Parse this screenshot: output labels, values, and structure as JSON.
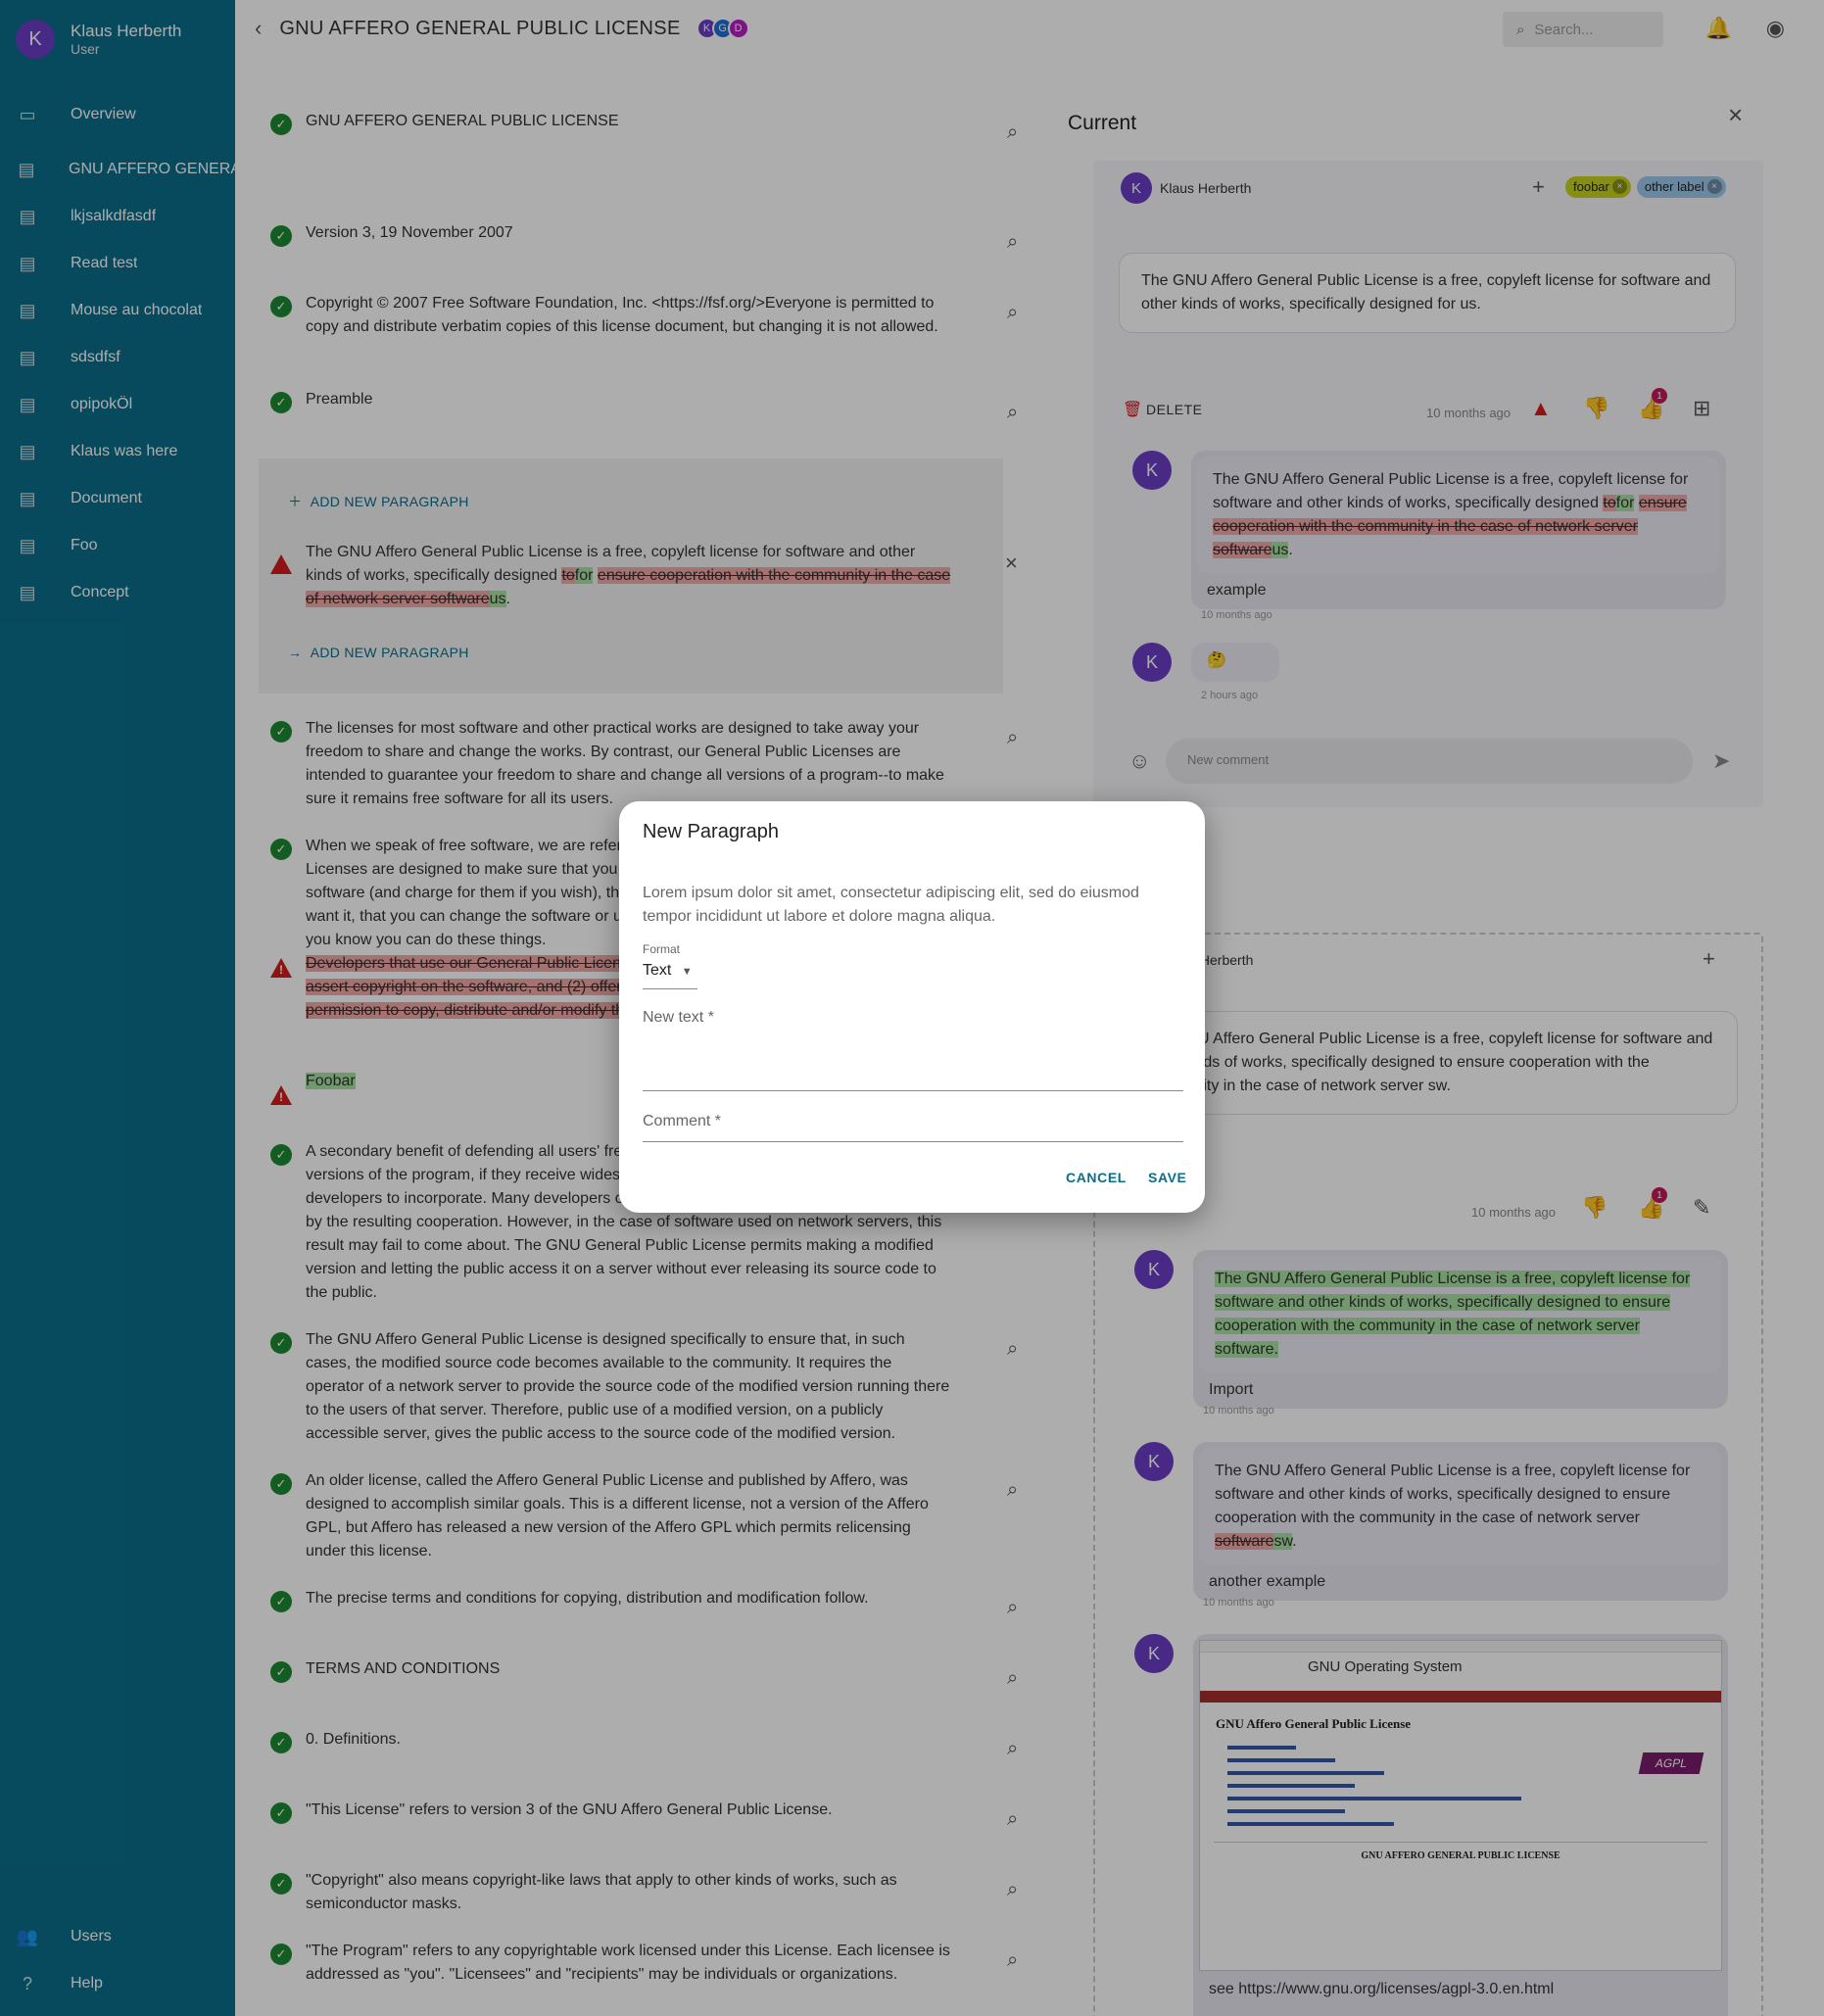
{
  "user": {
    "initial": "K",
    "name": "Klaus Herberth",
    "role": "User"
  },
  "sidebar": {
    "items": [
      {
        "label": "Overview",
        "icon": "overview-icon"
      },
      {
        "label": "GNU AFFERO GENERAL PUBLIC LICENSE",
        "icon": "document-icon"
      },
      {
        "label": "lkjsalkdfasdf",
        "icon": "document-icon"
      },
      {
        "label": "Read test",
        "icon": "document-icon"
      },
      {
        "label": "Mouse au chocolat",
        "icon": "document-icon"
      },
      {
        "label": "sdsdfsf",
        "icon": "document-icon"
      },
      {
        "label": "opipokÖl",
        "icon": "document-icon"
      },
      {
        "label": "Klaus was here",
        "icon": "document-icon"
      },
      {
        "label": "Document",
        "icon": "document-icon"
      },
      {
        "label": "Foo",
        "icon": "document-icon"
      },
      {
        "label": "Concept",
        "icon": "document-icon"
      }
    ],
    "bottom": [
      {
        "label": "Users",
        "icon": "users-icon"
      },
      {
        "label": "Help",
        "icon": "help-icon"
      }
    ]
  },
  "topbar": {
    "title": "GNU AFFERO GENERAL PUBLIC LICENSE",
    "participants": [
      {
        "initial": "K",
        "color": "#6a3fc6"
      },
      {
        "initial": "G",
        "color": "#1e6fd9"
      },
      {
        "initial": "D",
        "color": "#b81ec2"
      }
    ],
    "search_placeholder": "Search..."
  },
  "document": {
    "title": "GNU AFFERO GENERAL PUBLIC LICENSE",
    "version": "Version 3, 19 November 2007",
    "copyright": "Copyright © 2007 Free Software Foundation, Inc. <https://fsf.org/>Everyone is permitted to copy and distribute verbatim copies of this license document, but changing it is not allowed.",
    "preamble": "Preamble",
    "add_new_paragraph": "ADD NEW PARAGRAPH",
    "edit_para": {
      "prefix": "The GNU Affero General Public License is a free, copyleft license for software and other kinds of works, specifically designed ",
      "del1": "to",
      "ins1": "for",
      "del2": "ensure cooperation with the community in the case of network server software",
      "ins2": "us",
      "suffix": "."
    },
    "p1": "The licenses for most software and other practical works are designed to take away your freedom to share and change the works. By contrast, our General Public Licenses are intended to guarantee your freedom to share and change all versions of a program--to make sure it remains free software for all its users.",
    "p2": "When we speak of free software, we are referring to freedom, not price. Our General Public Licenses are designed to make sure that you have the freedom to distribute copies of free software (and charge for them if you wish), that you receive source code or can get it if you want it, that you can change the software or use pieces of it in new free programs, and that you know you can do these things.",
    "p3_deleted": "Developers that use our General Public Licenses protect your rights with two steps: (1) assert copyright on the software, and (2) offer you this License which gives you legal permission to copy, distribute and/or modify the software.",
    "p4_inserted": "Foobar",
    "p5": "A secondary benefit of defending all users' freedom is that improvements made in alternate versions of the program, if they receive widespread use, become available for other developers to incorporate. Many developers of free software are heartened and encouraged by the resulting cooperation. However, in the case of software used on network servers, this result may fail to come about. The GNU General Public License permits making a modified version and letting the public access it on a server without ever releasing its source code to the public.",
    "p6": "The GNU Affero General Public License is designed specifically to ensure that, in such cases, the modified source code becomes available to the community. It requires the operator of a network server to provide the source code of the modified version running there to the users of that server. Therefore, public use of a modified version, on a publicly accessible server, gives the public access to the source code of the modified version.",
    "p7": "An older license, called the Affero General Public License and published by Affero, was designed to accomplish similar goals. This is a different license, not a version of the Affero GPL, but Affero has released a new version of the Affero GPL which permits relicensing under this license.",
    "p8": "The precise terms and conditions for copying, distribution and modification follow.",
    "terms": "TERMS AND CONDITIONS",
    "definitions": "0. Definitions.",
    "p9": "\"This License\" refers to version 3 of the GNU Affero General Public License.",
    "p10": "\"Copyright\" also means copyright-like laws that apply to other kinds of works, such as semiconductor masks.",
    "p11": "\"The Program\" refers to any copyrightable work licensed under this License. Each licensee is addressed as \"you\". \"Licensees\" and \"recipients\" may be individuals or organizations."
  },
  "panel": {
    "title": "Current",
    "card1": {
      "author": "Klaus Herberth",
      "labels": [
        {
          "text": "foobar",
          "color": "#c6d31d"
        },
        {
          "text": "other label",
          "color": "#9cc8ec"
        }
      ],
      "quote": "The GNU Affero General Public License is a free, copyleft license for software and other kinds of works, specifically designed for us.",
      "delete_label": "DELETE",
      "time": "10 months ago",
      "like_count": "1",
      "comment1": {
        "prefix": "The GNU Affero General Public License is a free, copyleft license for software and other kinds of works, specifically designed ",
        "del1": "to",
        "ins1": "for",
        "del2": "ensure cooperation with the community in the case of network server software",
        "ins2": "us",
        "suffix": ".",
        "note": "example",
        "time": "10 months ago"
      },
      "comment2": {
        "emoji": "🤔",
        "time": "2 hours ago"
      },
      "new_comment_placeholder": "New comment"
    },
    "card2": {
      "author": "Klaus Herberth",
      "quote": "The GNU Affero General Public License is a free, copyleft license for software and other kinds of works, specifically designed to ensure cooperation with the community in the case of network server sw.",
      "time": "10 months ago",
      "like_count": "1",
      "comment1": {
        "text": "The GNU Affero General Public License is a free, copyleft license for software and other kinds of works, specifically designed to ensure cooperation with the community in the case of network server software.",
        "note": "Import",
        "time": "10 months ago"
      },
      "comment2": {
        "prefix": "The GNU Affero General Public License is a free, copyleft license for software and other kinds of works, specifically designed to ensure cooperation with the community in the case of network server ",
        "del": "software",
        "ins": "sw",
        "suffix": ".",
        "note": "another example",
        "time": "10 months ago"
      },
      "comment3": {
        "screenshot_site": "GNU Operating System",
        "screenshot_heading": "GNU Affero General Public License",
        "screenshot_doc_title": "GNU AFFERO GENERAL PUBLIC LICENSE",
        "note": "see https://www.gnu.org/licenses/agpl-3.0.en.html"
      }
    }
  },
  "dialog": {
    "title": "New Paragraph",
    "description": "Lorem ipsum dolor sit amet, consectetur adipiscing elit, sed do eiusmod tempor incididunt ut labore et dolore magna aliqua.",
    "format_label": "Format",
    "format_value": "Text",
    "new_text_label": "New text *",
    "comment_label": "Comment *",
    "cancel": "CANCEL",
    "save": "SAVE"
  }
}
